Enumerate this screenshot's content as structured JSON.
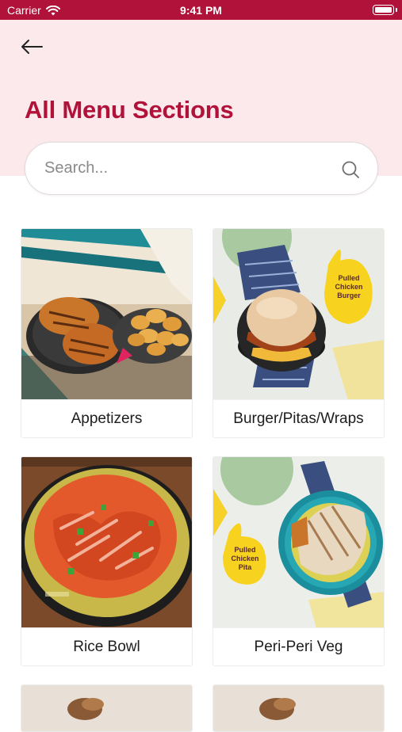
{
  "status_bar": {
    "carrier": "Carrier",
    "time": "9:41 PM"
  },
  "header": {
    "title": "All Menu Sections"
  },
  "search": {
    "placeholder": "Search..."
  },
  "menu_sections": [
    {
      "label": "Appetizers"
    },
    {
      "label": "Burger/Pitas/Wraps",
      "badge_text": "Pulled Chicken Burger"
    },
    {
      "label": "Rice Bowl"
    },
    {
      "label": "Peri-Peri Veg",
      "badge_text": "Pulled Chicken Pita"
    }
  ],
  "colors": {
    "brand": "#b1123a",
    "hero_bg": "#fbe9ec",
    "badge": "#f7d21e"
  }
}
